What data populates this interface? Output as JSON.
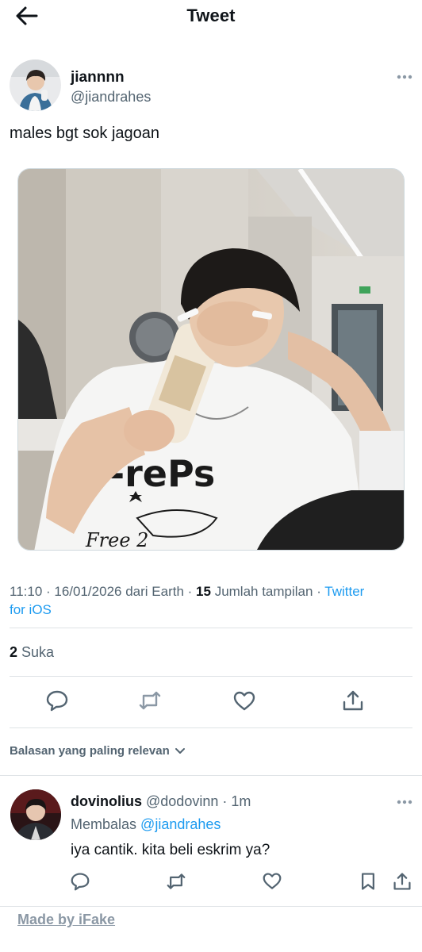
{
  "header": {
    "title": "Tweet",
    "back_icon": "arrow-left-icon"
  },
  "tweet": {
    "author_name": "jiannnn",
    "author_handle": "@jiandrahes",
    "text": "males bgt sok jagoan",
    "time": "11:10",
    "date": "16/01/2026",
    "location": "dari Earth",
    "views_count": "15",
    "views_label": "Jumlah tampilan",
    "source_part1": "Twitter",
    "source_part2": "for iOS",
    "likes_count": "2",
    "likes_label": "Suka"
  },
  "actions": [
    "reply-icon",
    "retweet-icon",
    "like-icon",
    "share-icon"
  ],
  "replies_sort": {
    "label": "Balasan yang paling relevan",
    "icon": "chevron-down-icon"
  },
  "reply": {
    "name": "dovinolius",
    "handle": "@dodovinn",
    "sep": "·",
    "time": "1m",
    "replying_label": "Membalas",
    "replying_to": "@jiandrahes",
    "text": "iya cantik. kita beli eskrim ya?",
    "actions": [
      "reply-icon",
      "retweet-icon",
      "like-icon",
      "bookmark-icon",
      "share-icon"
    ]
  },
  "watermark": "Made by iFake",
  "colors": {
    "accent": "#1d9bf0",
    "secondary_text": "#536471",
    "divider": "#dfe3e6"
  }
}
